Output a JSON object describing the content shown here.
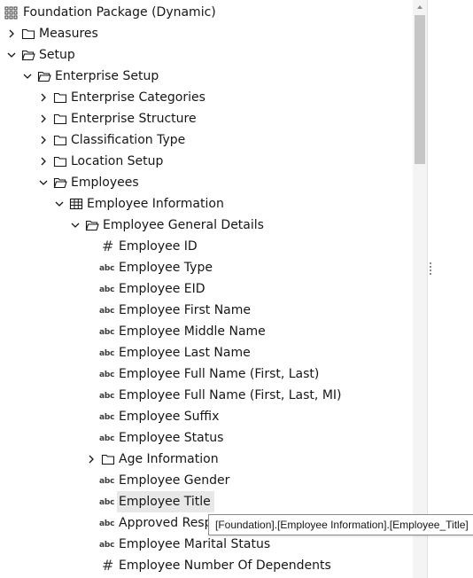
{
  "tree": {
    "rows": [
      {
        "label": "Foundation Package (Dynamic)",
        "icon": "package-icon",
        "caret": "none",
        "indent": 0
      },
      {
        "label": "Measures",
        "icon": "folder-icon",
        "caret": "collapsed",
        "indent": 0
      },
      {
        "label": "Setup",
        "icon": "folder-open-icon",
        "caret": "expanded",
        "indent": 0
      },
      {
        "label": "Enterprise Setup",
        "icon": "folder-open-icon",
        "caret": "expanded",
        "indent": 1
      },
      {
        "label": "Enterprise Categories",
        "icon": "folder-icon",
        "caret": "collapsed",
        "indent": 2
      },
      {
        "label": "Enterprise Structure",
        "icon": "folder-icon",
        "caret": "collapsed",
        "indent": 2
      },
      {
        "label": "Classification Type",
        "icon": "folder-icon",
        "caret": "collapsed",
        "indent": 2
      },
      {
        "label": "Location Setup",
        "icon": "folder-icon",
        "caret": "collapsed",
        "indent": 2
      },
      {
        "label": "Employees",
        "icon": "folder-open-icon",
        "caret": "expanded",
        "indent": 2
      },
      {
        "label": "Employee Information",
        "icon": "table-icon",
        "caret": "expanded",
        "indent": 3
      },
      {
        "label": "Employee General Details",
        "icon": "folder-open-icon",
        "caret": "expanded",
        "indent": 4
      },
      {
        "label": "Employee ID",
        "icon": "numeric-icon",
        "caret": "none",
        "indent": 5
      },
      {
        "label": "Employee Type",
        "icon": "text-icon",
        "caret": "none",
        "indent": 5
      },
      {
        "label": "Employee EID",
        "icon": "text-icon",
        "caret": "none",
        "indent": 5
      },
      {
        "label": "Employee First Name",
        "icon": "text-icon",
        "caret": "none",
        "indent": 5
      },
      {
        "label": "Employee Middle Name",
        "icon": "text-icon",
        "caret": "none",
        "indent": 5
      },
      {
        "label": "Employee Last Name",
        "icon": "text-icon",
        "caret": "none",
        "indent": 5
      },
      {
        "label": "Employee Full Name (First, Last)",
        "icon": "text-icon",
        "caret": "none",
        "indent": 5
      },
      {
        "label": "Employee Full Name (First, Last, MI)",
        "icon": "text-icon",
        "caret": "none",
        "indent": 5
      },
      {
        "label": "Employee Suffix",
        "icon": "text-icon",
        "caret": "none",
        "indent": 5
      },
      {
        "label": "Employee Status",
        "icon": "text-icon",
        "caret": "none",
        "indent": 5
      },
      {
        "label": "Age Information",
        "icon": "folder-icon",
        "caret": "collapsed",
        "indent": 5
      },
      {
        "label": "Employee Gender",
        "icon": "text-icon",
        "caret": "none",
        "indent": 5
      },
      {
        "label": "Employee Title",
        "icon": "text-icon",
        "caret": "none",
        "indent": 5,
        "highlighted": true
      },
      {
        "label": "Approved Respi",
        "icon": "text-icon",
        "caret": "none",
        "indent": 5
      },
      {
        "label": "Employee Marital Status",
        "icon": "text-icon",
        "caret": "none",
        "indent": 5
      },
      {
        "label": "Employee Number Of Dependents",
        "icon": "numeric-icon",
        "caret": "none",
        "indent": 5
      }
    ]
  },
  "icons": {
    "text_glyph": "abc",
    "numeric_glyph": "#"
  },
  "tooltip": {
    "text": "[Foundation].[Employee Information].[Employee_Title]"
  },
  "colors": {
    "highlight": "#e8e8e8",
    "scrollbar_track": "#f4f4f4",
    "scrollbar_thumb": "#c6c6c6"
  }
}
